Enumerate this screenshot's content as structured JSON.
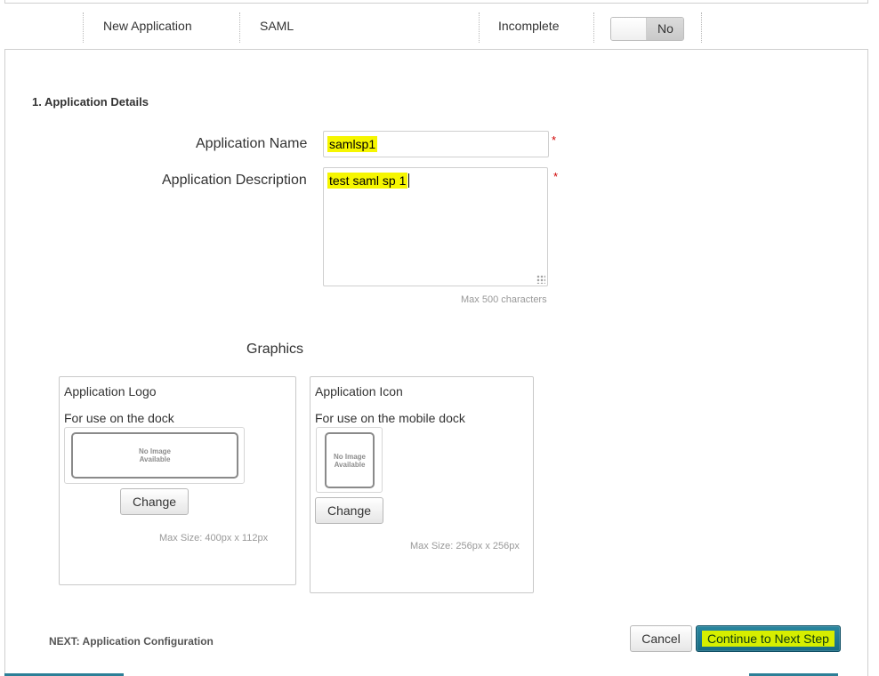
{
  "header": {
    "app_name": "New Application",
    "protocol": "SAML",
    "status": "Incomplete",
    "toggle_state": "No"
  },
  "section": {
    "title": "1. Application Details"
  },
  "form": {
    "name_label": "Application Name",
    "name_value": "samlsp1",
    "description_label": "Application Description",
    "description_value": "test saml sp 1",
    "required_mark": "*",
    "description_limit": "Max 500 characters"
  },
  "graphics": {
    "title": "Graphics",
    "logo": {
      "title": "Application Logo",
      "subtitle": "For use on the dock",
      "placeholder_line1": "No Image",
      "placeholder_line2": "Available",
      "button": "Change",
      "max_size": "Max Size: 400px x 112px"
    },
    "icon": {
      "title": "Application Icon",
      "subtitle": "For use on the mobile dock",
      "placeholder_line1": "No Image",
      "placeholder_line2": "Available",
      "button": "Change",
      "max_size": "Max Size: 256px x 256px"
    }
  },
  "footer": {
    "next_label": "NEXT: Application Configuration",
    "cancel": "Cancel",
    "continue": "Continue to Next Step"
  },
  "colors": {
    "highlight": "#f6f600",
    "primary_button": "#176a82",
    "required": "#d00000"
  }
}
